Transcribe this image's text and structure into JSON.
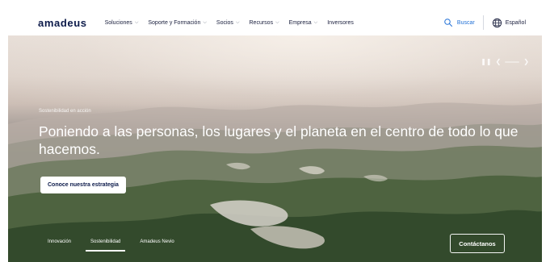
{
  "brand": {
    "logo_text": "amadeus"
  },
  "nav": {
    "items": [
      {
        "label": "Soluciones",
        "has_dropdown": true
      },
      {
        "label": "Soporte y Formación",
        "has_dropdown": true
      },
      {
        "label": "Socios",
        "has_dropdown": true
      },
      {
        "label": "Recursos",
        "has_dropdown": true
      },
      {
        "label": "Empresa",
        "has_dropdown": true
      },
      {
        "label": "Inversores",
        "has_dropdown": false
      }
    ],
    "search_label": "Buscar",
    "language_label": "Español"
  },
  "hero": {
    "eyebrow": "Sostenibilidad en acción",
    "headline": "Poniendo a las personas, los lugares y el planeta en el centro de todo lo que hacemos.",
    "cta_label": "Conoce nuestra estrategia",
    "tabs": [
      {
        "label": "Innovación",
        "active": false
      },
      {
        "label": "Sostenibilidad",
        "active": true
      },
      {
        "label": "Amadeus Nevio",
        "active": false
      }
    ],
    "contact_label": "Contáctanos"
  },
  "icons": {
    "search": "search-icon",
    "language": "globe-icon",
    "pause": "pause-icon",
    "prev": "chevron-left-icon",
    "next": "chevron-right-icon"
  },
  "colors": {
    "brand_navy": "#0c1a4a",
    "link_blue": "#1f6fd6",
    "white": "#ffffff"
  }
}
